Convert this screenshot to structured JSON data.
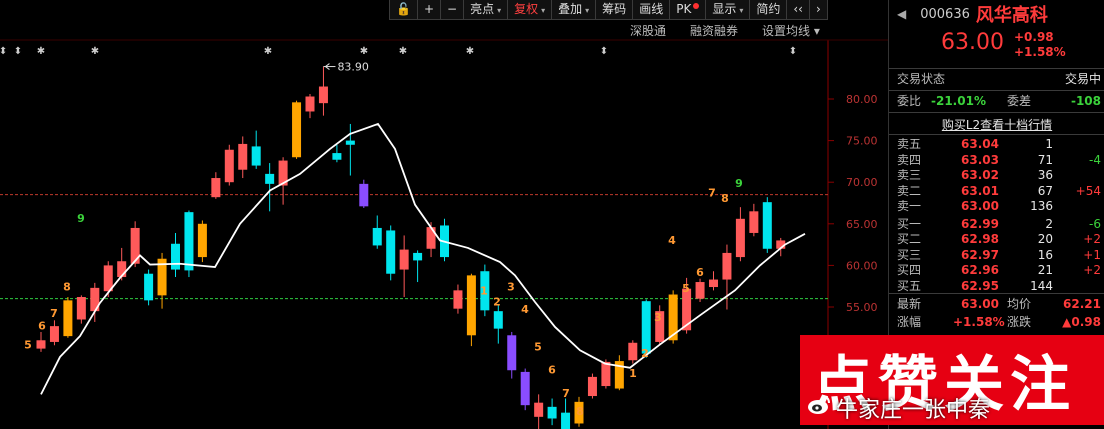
{
  "toolbar": {
    "buttons": [
      {
        "label": "亮点",
        "dropdown": true
      },
      {
        "label": "复权",
        "dropdown": true,
        "active": true
      },
      {
        "label": "叠加",
        "dropdown": true
      },
      {
        "label": "筹码"
      },
      {
        "label": "画线"
      },
      {
        "label": "PK",
        "dot": true
      },
      {
        "label": "显示",
        "dropdown": true
      },
      {
        "label": "简约"
      }
    ],
    "sub_items": [
      "深股通",
      "融资融券",
      "设置均线"
    ]
  },
  "panel": {
    "code": "000636",
    "name": "风华高科",
    "price": "63.00",
    "change": "+0.98",
    "change_pct": "+1.58%",
    "trade_status_label": "交易状态",
    "trade_status_value": "交易中",
    "weibi_label": "委比",
    "weibi_value": "-21.01%",
    "weicha_label": "委差",
    "weicha_value": "-108",
    "l2_link": "购买L2查看十档行情",
    "asks": [
      {
        "label": "卖五",
        "price": "63.04",
        "vol": "1",
        "delta": ""
      },
      {
        "label": "卖四",
        "price": "63.03",
        "vol": "71",
        "delta": "-4"
      },
      {
        "label": "卖三",
        "price": "63.02",
        "vol": "36",
        "delta": ""
      },
      {
        "label": "卖二",
        "price": "63.01",
        "vol": "67",
        "delta": "+54"
      },
      {
        "label": "卖一",
        "price": "63.00",
        "vol": "136",
        "delta": ""
      }
    ],
    "bids": [
      {
        "label": "买一",
        "price": "62.99",
        "vol": "2",
        "delta": "-6"
      },
      {
        "label": "买二",
        "price": "62.98",
        "vol": "20",
        "delta": "+2"
      },
      {
        "label": "买三",
        "price": "62.97",
        "vol": "16",
        "delta": "+1"
      },
      {
        "label": "买四",
        "price": "62.96",
        "vol": "21",
        "delta": "+2"
      },
      {
        "label": "买五",
        "price": "62.95",
        "vol": "144",
        "delta": ""
      }
    ],
    "latest_label": "最新",
    "latest_value": "63.00",
    "avg_label": "均价",
    "avg_value": "62.21",
    "zf_label": "涨幅",
    "zf_value": "+1.58%",
    "zd_label": "涨跌",
    "zd_value": "▲0.98"
  },
  "watermark": {
    "main": "点赞关注",
    "sub": "牛家庄一张中秦"
  },
  "chart_data": {
    "type": "candlestick",
    "y_ticks": [
      "80.00",
      "75.00",
      "70.00",
      "65.00",
      "60.00",
      "55.00"
    ],
    "ylim": [
      50.5,
      83.3
    ],
    "high_label": "83.90",
    "ref_lines": [
      68.5,
      56.0
    ],
    "colors": {
      "up": "#ff5a5a",
      "down": "#00e5ee",
      "yellow": "#ffa500",
      "purple": "#8a4dff",
      "ma": "#ffffff"
    },
    "candles": [
      {
        "o": 50.0,
        "c": 51.0,
        "h": 52.0,
        "l": 49.6,
        "color": "up"
      },
      {
        "o": 50.8,
        "c": 52.7,
        "h": 53.4,
        "l": 50.4,
        "color": "up"
      },
      {
        "o": 51.5,
        "c": 55.8,
        "h": 56.2,
        "l": 51.3,
        "color": "yellow"
      },
      {
        "o": 53.5,
        "c": 56.2,
        "h": 56.4,
        "l": 53.0,
        "color": "up"
      },
      {
        "o": 54.5,
        "c": 57.3,
        "h": 57.9,
        "l": 53.2,
        "color": "up"
      },
      {
        "o": 56.9,
        "c": 60.0,
        "h": 60.5,
        "l": 56.2,
        "color": "up"
      },
      {
        "o": 58.6,
        "c": 60.5,
        "h": 62.1,
        "l": 58.2,
        "color": "up"
      },
      {
        "o": 60.2,
        "c": 64.5,
        "h": 65.3,
        "l": 59.8,
        "color": "up"
      },
      {
        "o": 59.0,
        "c": 55.8,
        "h": 59.5,
        "l": 55.2,
        "color": "down"
      },
      {
        "o": 56.4,
        "c": 60.8,
        "h": 61.5,
        "l": 54.8,
        "color": "yellow"
      },
      {
        "o": 62.6,
        "c": 59.5,
        "h": 63.9,
        "l": 58.6,
        "color": "down"
      },
      {
        "o": 66.4,
        "c": 59.4,
        "h": 66.6,
        "l": 58.6,
        "color": "down"
      },
      {
        "o": 61.0,
        "c": 65.0,
        "h": 65.4,
        "l": 60.4,
        "color": "yellow"
      },
      {
        "o": 68.2,
        "c": 70.5,
        "h": 71.2,
        "l": 68.0,
        "color": "up"
      },
      {
        "o": 70.0,
        "c": 73.9,
        "h": 74.5,
        "l": 69.6,
        "color": "up"
      },
      {
        "o": 71.5,
        "c": 74.6,
        "h": 75.5,
        "l": 70.5,
        "color": "up"
      },
      {
        "o": 74.3,
        "c": 72.0,
        "h": 76.2,
        "l": 71.6,
        "color": "down"
      },
      {
        "o": 71.0,
        "c": 69.8,
        "h": 72.3,
        "l": 66.5,
        "color": "down"
      },
      {
        "o": 69.6,
        "c": 72.6,
        "h": 73.0,
        "l": 67.3,
        "color": "up"
      },
      {
        "o": 73.0,
        "c": 79.6,
        "h": 79.8,
        "l": 72.8,
        "color": "yellow"
      },
      {
        "o": 78.5,
        "c": 80.3,
        "h": 80.6,
        "l": 77.7,
        "color": "up"
      },
      {
        "o": 79.5,
        "c": 81.5,
        "h": 83.9,
        "l": 78.0,
        "color": "up"
      },
      {
        "o": 73.5,
        "c": 72.7,
        "h": 74.5,
        "l": 72.4,
        "color": "down"
      },
      {
        "o": 75.0,
        "c": 74.5,
        "h": 77.0,
        "l": 70.8,
        "color": "down"
      },
      {
        "o": 69.8,
        "c": 67.1,
        "h": 70.3,
        "l": 66.9,
        "color": "purple"
      },
      {
        "o": 64.5,
        "c": 62.4,
        "h": 66.0,
        "l": 62.0,
        "color": "down"
      },
      {
        "o": 64.2,
        "c": 59.0,
        "h": 64.8,
        "l": 58.2,
        "color": "down"
      },
      {
        "o": 59.5,
        "c": 61.9,
        "h": 63.6,
        "l": 56.2,
        "color": "up"
      },
      {
        "o": 60.6,
        "c": 61.5,
        "h": 61.8,
        "l": 58.0,
        "color": "down"
      },
      {
        "o": 62.0,
        "c": 64.6,
        "h": 65.2,
        "l": 61.0,
        "color": "up"
      },
      {
        "o": 64.8,
        "c": 61.0,
        "h": 65.6,
        "l": 60.5,
        "color": "down"
      },
      {
        "o": 57.0,
        "c": 54.8,
        "h": 57.7,
        "l": 54.2,
        "color": "up"
      },
      {
        "o": 58.8,
        "c": 51.6,
        "h": 59.0,
        "l": 50.3,
        "color": "yellow"
      },
      {
        "o": 59.3,
        "c": 54.6,
        "h": 60.1,
        "l": 53.9,
        "color": "down"
      },
      {
        "o": 54.5,
        "c": 52.4,
        "h": 55.2,
        "l": 50.6,
        "color": "down"
      },
      {
        "o": 51.6,
        "c": 47.4,
        "h": 52.0,
        "l": 46.4,
        "color": "purple"
      },
      {
        "o": 47.2,
        "c": 43.2,
        "h": 47.6,
        "l": 42.6,
        "color": "purple"
      },
      {
        "o": 41.8,
        "c": 43.5,
        "h": 44.5,
        "l": 39.8,
        "color": "up"
      },
      {
        "o": 43.0,
        "c": 41.6,
        "h": 44.0,
        "l": 40.8,
        "color": "down"
      },
      {
        "o": 42.3,
        "c": 39.2,
        "h": 44.0,
        "l": 38.5,
        "color": "down"
      },
      {
        "o": 41.0,
        "c": 43.6,
        "h": 44.2,
        "l": 40.6,
        "color": "yellow"
      },
      {
        "o": 44.3,
        "c": 46.6,
        "h": 47.0,
        "l": 44.0,
        "color": "up"
      },
      {
        "o": 45.5,
        "c": 48.4,
        "h": 48.7,
        "l": 45.2,
        "color": "up"
      },
      {
        "o": 45.2,
        "c": 48.5,
        "h": 49.2,
        "l": 45.0,
        "color": "yellow"
      },
      {
        "o": 48.6,
        "c": 50.7,
        "h": 51.0,
        "l": 48.2,
        "color": "up"
      },
      {
        "o": 49.4,
        "c": 55.7,
        "h": 55.9,
        "l": 48.9,
        "color": "down"
      },
      {
        "o": 50.8,
        "c": 54.5,
        "h": 55.2,
        "l": 50.5,
        "color": "up"
      },
      {
        "o": 51.0,
        "c": 56.5,
        "h": 57.0,
        "l": 50.6,
        "color": "yellow"
      },
      {
        "o": 52.2,
        "c": 57.2,
        "h": 58.5,
        "l": 51.8,
        "color": "up"
      },
      {
        "o": 56.0,
        "c": 58.0,
        "h": 58.4,
        "l": 55.6,
        "color": "up"
      },
      {
        "o": 57.4,
        "c": 58.3,
        "h": 59.3,
        "l": 57.0,
        "color": "up"
      },
      {
        "o": 58.3,
        "c": 61.5,
        "h": 62.5,
        "l": 54.7,
        "color": "up"
      },
      {
        "o": 61.0,
        "c": 65.6,
        "h": 67.0,
        "l": 60.5,
        "color": "up"
      },
      {
        "o": 63.9,
        "c": 66.5,
        "h": 67.4,
        "l": 63.5,
        "color": "up"
      },
      {
        "o": 67.6,
        "c": 62.0,
        "h": 68.2,
        "l": 61.5,
        "color": "down"
      },
      {
        "o": 62.0,
        "c": 63.0,
        "h": 63.3,
        "l": 61.1,
        "color": "up"
      }
    ],
    "ma": [
      [
        41,
        44.5
      ],
      [
        60,
        49.0
      ],
      [
        80,
        51.5
      ],
      [
        100,
        55.5
      ],
      [
        120,
        58.5
      ],
      [
        140,
        61.2
      ],
      [
        150,
        60.1
      ],
      [
        180,
        60.2
      ],
      [
        215,
        59.8
      ],
      [
        240,
        65.0
      ],
      [
        270,
        69.0
      ],
      [
        300,
        71.0
      ],
      [
        330,
        74.0
      ],
      [
        350,
        75.8
      ],
      [
        378,
        77.0
      ],
      [
        395,
        74.0
      ],
      [
        415,
        67.3
      ],
      [
        440,
        63.0
      ],
      [
        468,
        62.1
      ],
      [
        500,
        60.4
      ],
      [
        515,
        58.8
      ],
      [
        535,
        55.6
      ],
      [
        555,
        52.6
      ],
      [
        580,
        49.8
      ],
      [
        605,
        48.2
      ],
      [
        630,
        47.7
      ],
      [
        660,
        50.5
      ],
      [
        700,
        54.0
      ],
      [
        735,
        57.0
      ],
      [
        760,
        60.0
      ],
      [
        785,
        62.5
      ],
      [
        805,
        63.8
      ]
    ],
    "ma_y_scale": "x_pixel,data_value",
    "wave_labels": [
      {
        "x": 28,
        "text": "5",
        "color": "#ff9933",
        "y": 50.0
      },
      {
        "x": 42,
        "text": "6",
        "color": "#ff9933",
        "y": 52.3
      },
      {
        "x": 54,
        "text": "7",
        "color": "#ff9933",
        "y": 53.8
      },
      {
        "x": 67,
        "text": "8",
        "color": "#ff9933",
        "y": 57.0
      },
      {
        "x": 81,
        "text": "9",
        "color": "#3bd23b",
        "y": 65.2
      },
      {
        "x": 484,
        "text": "1",
        "color": "#ff9933",
        "y": 56.5
      },
      {
        "x": 497,
        "text": "2",
        "color": "#ff9933",
        "y": 55.2
      },
      {
        "x": 511,
        "text": "3",
        "color": "#ff9933",
        "y": 57.0
      },
      {
        "x": 525,
        "text": "4",
        "color": "#ff9933",
        "y": 54.3
      },
      {
        "x": 538,
        "text": "5",
        "color": "#ff9933",
        "y": 49.8
      },
      {
        "x": 552,
        "text": "6",
        "color": "#ff9933",
        "y": 47.0
      },
      {
        "x": 566,
        "text": "7",
        "color": "#ff9933",
        "y": 44.2
      },
      {
        "x": 580,
        "text": "8",
        "color": "#ff9933",
        "y": 42.0
      },
      {
        "x": 594,
        "text": "9",
        "color": "#ff9933",
        "y": 39.4
      },
      {
        "x": 633,
        "text": "1",
        "color": "#ff9933",
        "y": 46.6
      },
      {
        "x": 645,
        "text": "2",
        "color": "#ff9933",
        "y": 49.0
      },
      {
        "x": 658,
        "text": "3",
        "color": "#ff9933",
        "y": 53.3
      },
      {
        "x": 672,
        "text": "4",
        "color": "#ff9933",
        "y": 62.6
      },
      {
        "x": 686,
        "text": "5",
        "color": "#ff9933",
        "y": 56.8
      },
      {
        "x": 700,
        "text": "6",
        "color": "#ff9933",
        "y": 58.7
      },
      {
        "x": 712,
        "text": "7",
        "color": "#ff9933",
        "y": 68.3
      },
      {
        "x": 725,
        "text": "8",
        "color": "#ff9933",
        "y": 67.6
      },
      {
        "x": 739,
        "text": "9",
        "color": "#3bd23b",
        "y": 69.4
      }
    ],
    "markers": [
      {
        "x": 3,
        "sym": "⬍"
      },
      {
        "x": 18,
        "sym": "⬍"
      },
      {
        "x": 41,
        "sym": "✱"
      },
      {
        "x": 95,
        "sym": "✱"
      },
      {
        "x": 268,
        "sym": "✱"
      },
      {
        "x": 364,
        "sym": "✱"
      },
      {
        "x": 403,
        "sym": "✱"
      },
      {
        "x": 470,
        "sym": "✱"
      },
      {
        "x": 604,
        "sym": "⬍"
      },
      {
        "x": 793,
        "sym": "⬍"
      }
    ]
  }
}
